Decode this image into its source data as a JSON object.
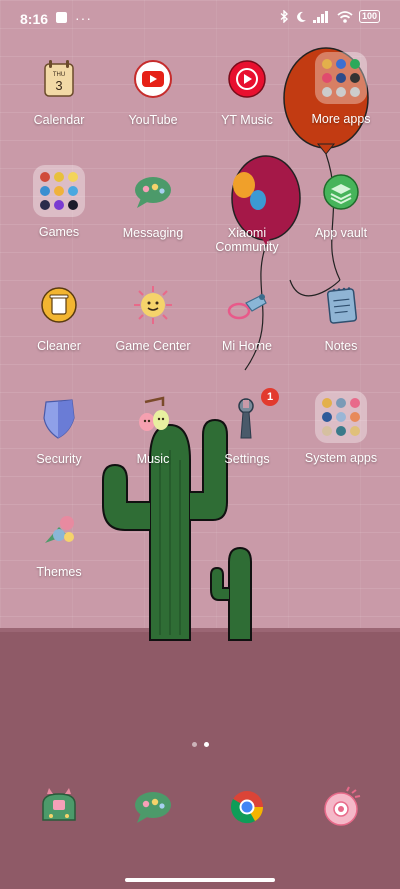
{
  "status_bar": {
    "time": "8:16",
    "battery": "100"
  },
  "apps": [
    {
      "label": "Calendar",
      "icon": "calendar-icon",
      "calendar_day": "THU",
      "calendar_date": "3"
    },
    {
      "label": "YouTube",
      "icon": "youtube-icon"
    },
    {
      "label": "YT Music",
      "icon": "yt-music-icon"
    },
    {
      "label": "More apps",
      "icon": "folder-icon"
    },
    {
      "label": "Games",
      "icon": "folder-icon"
    },
    {
      "label": "Messaging",
      "icon": "messaging-icon"
    },
    {
      "label": "Xiaomi Community",
      "icon": "xiaomi-community-icon"
    },
    {
      "label": "App vault",
      "icon": "app-vault-icon"
    },
    {
      "label": "Cleaner",
      "icon": "cleaner-icon"
    },
    {
      "label": "Game Center",
      "icon": "game-center-icon"
    },
    {
      "label": "Mi Home",
      "icon": "mi-home-icon"
    },
    {
      "label": "Notes",
      "icon": "notes-icon"
    },
    {
      "label": "Security",
      "icon": "security-icon"
    },
    {
      "label": "Music",
      "icon": "music-icon"
    },
    {
      "label": "Settings",
      "icon": "settings-icon",
      "badge": "1"
    },
    {
      "label": "System apps",
      "icon": "folder-icon"
    },
    {
      "label": "Themes",
      "icon": "themes-icon"
    }
  ],
  "dock": [
    {
      "icon": "phone-icon"
    },
    {
      "icon": "messaging-icon"
    },
    {
      "icon": "chrome-icon"
    },
    {
      "icon": "camera-icon"
    }
  ],
  "page_indicator": {
    "pages": 2,
    "active": 2
  },
  "colors": {
    "wallpaper": "#c99aa8",
    "floor": "#8f5a67",
    "badge": "#e23a2e"
  }
}
